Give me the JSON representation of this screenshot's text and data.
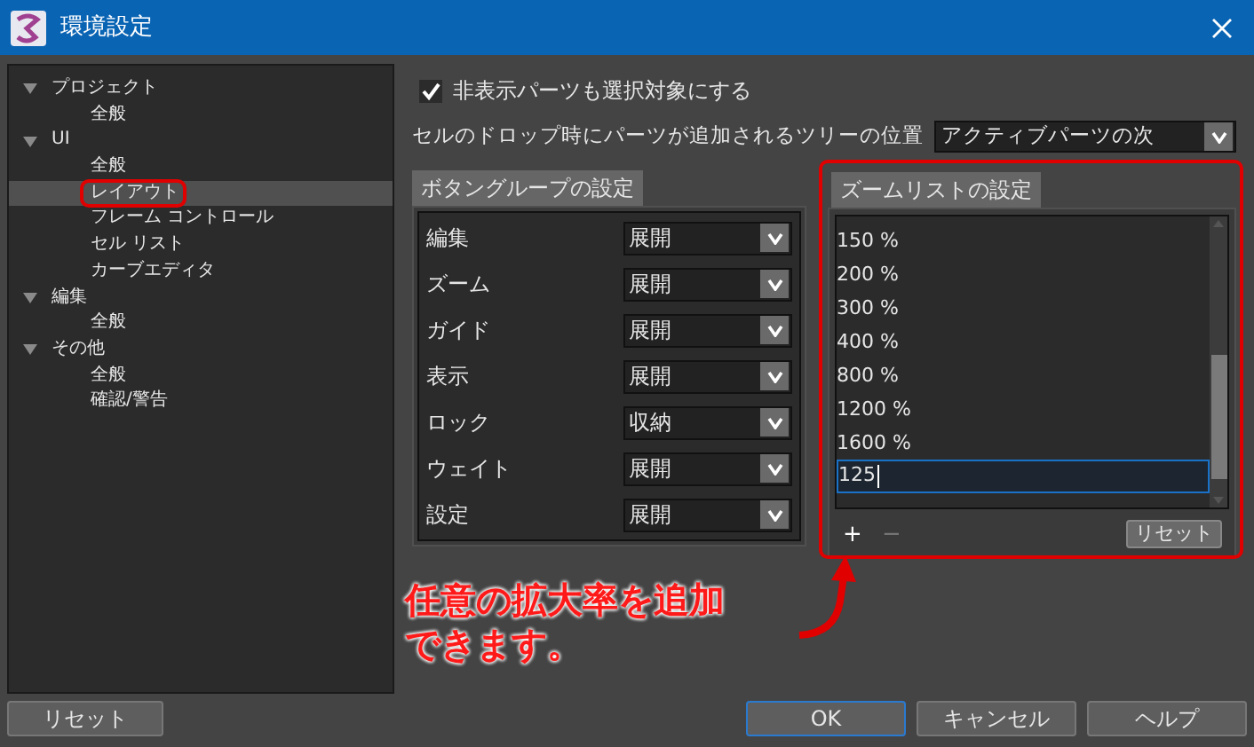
{
  "window": {
    "title": "環境設定"
  },
  "tree": [
    {
      "label": "プロジェクト",
      "expanded": true,
      "selected": false,
      "children": [
        {
          "label": "全般",
          "selected": false
        }
      ]
    },
    {
      "label": "UI",
      "expanded": true,
      "selected": false,
      "children": [
        {
          "label": "全般",
          "selected": false
        },
        {
          "label": "レイアウト",
          "selected": true
        },
        {
          "label": "フレーム コントロール",
          "selected": false
        },
        {
          "label": "セル リスト",
          "selected": false
        },
        {
          "label": "カーブエディタ",
          "selected": false
        }
      ]
    },
    {
      "label": "編集",
      "expanded": true,
      "selected": false,
      "children": [
        {
          "label": "全般",
          "selected": false
        }
      ]
    },
    {
      "label": "その他",
      "expanded": true,
      "selected": false,
      "children": [
        {
          "label": "全般",
          "selected": false
        },
        {
          "label": "確認/警告",
          "selected": false
        }
      ]
    }
  ],
  "hidden_parts": {
    "label": "非表示パーツも選択対象にする",
    "checked": true
  },
  "drop_position": {
    "label": "セルのドロップ時にパーツが追加されるツリーの位置",
    "value": "アクティブパーツの次"
  },
  "button_groups": {
    "title": "ボタングループの設定",
    "rows": [
      {
        "label": "編集",
        "value": "展開"
      },
      {
        "label": "ズーム",
        "value": "展開"
      },
      {
        "label": "ガイド",
        "value": "展開"
      },
      {
        "label": "表示",
        "value": "展開"
      },
      {
        "label": "ロック",
        "value": "収納"
      },
      {
        "label": "ウェイト",
        "value": "展開"
      },
      {
        "label": "設定",
        "value": "展開"
      }
    ]
  },
  "zoom_list": {
    "title": "ズームリストの設定",
    "items": [
      "150 %",
      "200 %",
      "300 %",
      "400 %",
      "800 %",
      "1200 %",
      "1600 %"
    ],
    "editing": "125",
    "add": {
      "label": "+",
      "disabled": false
    },
    "remove": {
      "label": "−",
      "disabled": true
    },
    "reset": "リセット"
  },
  "annotation": {
    "lines": [
      "任意の拡大率を追加",
      "できます。"
    ]
  },
  "footer": {
    "reset": "リセット",
    "buttons": [
      {
        "label": "OK",
        "default": true
      },
      {
        "label": "キャンセル",
        "default": false
      },
      {
        "label": "ヘルプ",
        "default": false
      }
    ]
  }
}
